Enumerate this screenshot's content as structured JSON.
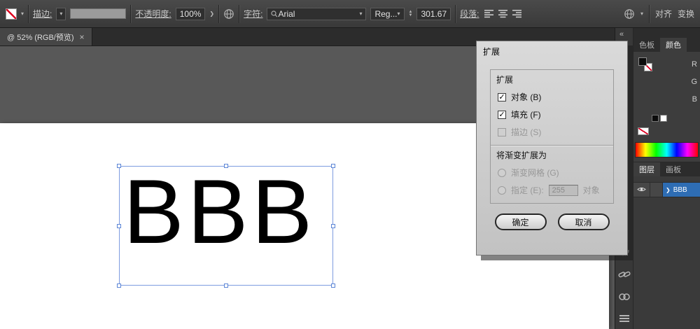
{
  "toolbar": {
    "stroke_label": "描边:",
    "opacity_label": "不透明度:",
    "opacity_value": "100%",
    "character_label": "字符:",
    "font_name": "Arial",
    "font_style": "Reg...",
    "font_size": "301.67",
    "paragraph_label": "段落:",
    "align_label": "对齐",
    "transform_label": "变换"
  },
  "tabbar": {
    "title": "@ 52% (RGB/预览)",
    "close_label": "×"
  },
  "canvas": {
    "artboard_text": "BBB"
  },
  "dialog": {
    "window_title": "扩展",
    "section_expand_title": "扩展",
    "checkbox_object": "对象 (B)",
    "checkbox_fill": "填充 (F)",
    "checkbox_stroke": "描边 (S)",
    "section_gradient_title": "将渐变扩展为",
    "radio_mesh": "渐变网格 (G)",
    "radio_specify": "指定 (E):",
    "specify_value": "255",
    "specify_suffix": "对象",
    "ok_label": "确定",
    "cancel_label": "取消"
  },
  "dock": {
    "collapse_label": "«",
    "color_tabs": {
      "swatches": "色板",
      "color": "颜色"
    },
    "rgb": {
      "r": "R",
      "g": "G",
      "b": "B"
    },
    "layer_tabs": {
      "layers": "图层",
      "artboards": "画板"
    },
    "layer_row": {
      "expand": "❯",
      "name": "BBB"
    }
  }
}
